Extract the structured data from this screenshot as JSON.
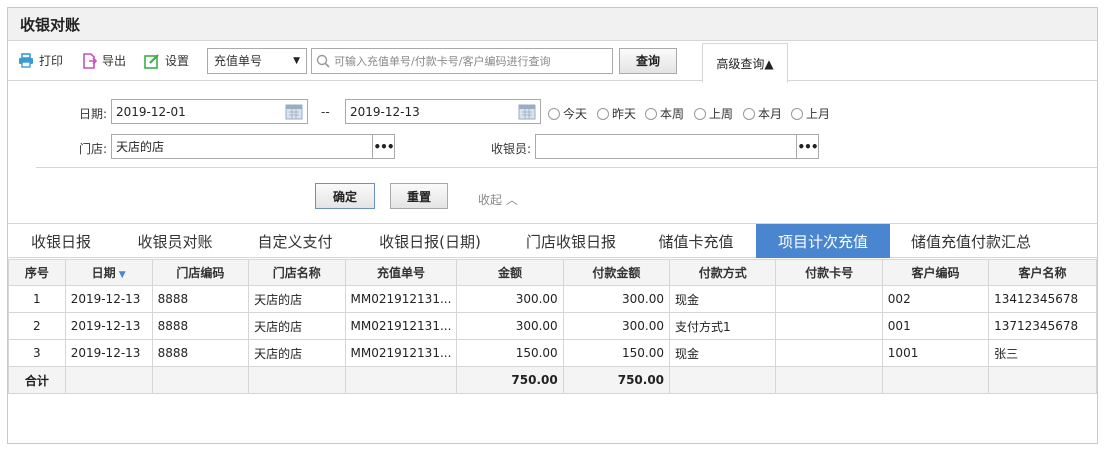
{
  "window": {
    "title": "收银对账"
  },
  "toolbar": {
    "print": "打印",
    "export": "导出",
    "settings": "设置",
    "select_value": "充值单号",
    "search_placeholder": "可输入充值单号/付款卡号/客户编码进行查询",
    "query": "查询",
    "advanced": "高级查询▲"
  },
  "filters": {
    "date_label": "日期:",
    "date_from": "2019-12-01",
    "date_sep": "--",
    "date_to": "2019-12-13",
    "quick": [
      "今天",
      "昨天",
      "本周",
      "上周",
      "本月",
      "上月"
    ],
    "store_label": "门店:",
    "store_value": "天店的店",
    "cashier_label": "收银员:",
    "cashier_value": "",
    "more": "•••",
    "confirm": "确定",
    "reset": "重置",
    "collapse": "收起 ︿"
  },
  "tabs": [
    "收银日报",
    "收银员对账",
    "自定义支付",
    "收银日报(日期)",
    "门店收银日报",
    "储值卡充值",
    "项目计次充值",
    "储值充值付款汇总"
  ],
  "active_tab": 6,
  "table": {
    "columns": [
      "序号",
      "日期",
      "门店编码",
      "门店名称",
      "充值单号",
      "金额",
      "付款金额",
      "付款方式",
      "付款卡号",
      "客户编码",
      "客户名称"
    ],
    "sort_indicator": "▼",
    "rows": [
      [
        "1",
        "2019-12-13",
        "8888",
        "天店的店",
        "MM021912131...",
        "300.00",
        "300.00",
        "现金",
        "",
        "002",
        "13412345678"
      ],
      [
        "2",
        "2019-12-13",
        "8888",
        "天店的店",
        "MM021912131...",
        "300.00",
        "300.00",
        "支付方式1",
        "",
        "001",
        "13712345678"
      ],
      [
        "3",
        "2019-12-13",
        "8888",
        "天店的店",
        "MM021912131...",
        "150.00",
        "150.00",
        "现金",
        "",
        "1001",
        "张三"
      ]
    ],
    "total": [
      "合计",
      "",
      "",
      "",
      "",
      "750.00",
      "750.00",
      "",
      "",
      "",
      ""
    ]
  },
  "colors": {
    "accent": "#4a86d0",
    "print_icon": "#3a9bd5",
    "export_icon": "#c94fc3",
    "settings_icon": "#3cae4a"
  }
}
